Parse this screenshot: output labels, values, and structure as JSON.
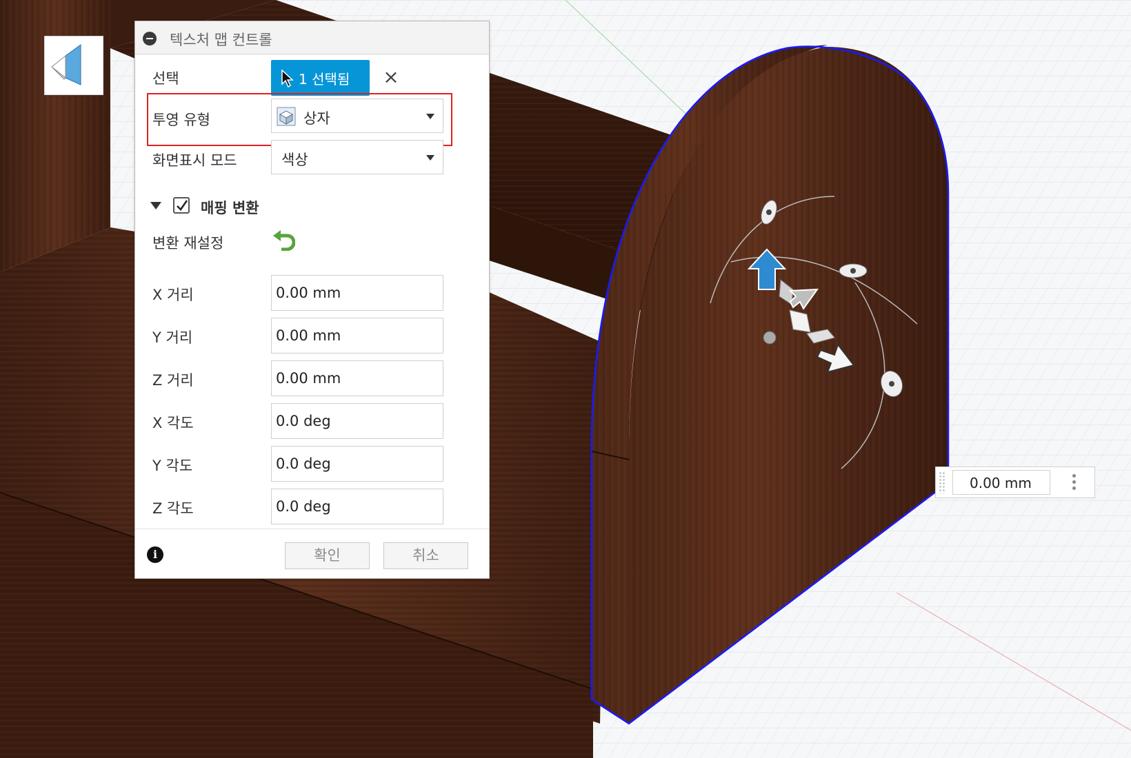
{
  "panel": {
    "title": "텍스처 맵 컨트롤",
    "selection_label": "선택",
    "selection_button": "1 선택됨",
    "projection_label": "투영 유형",
    "projection_value": "상자",
    "display_label": "화면표시 모드",
    "display_value": "색상",
    "mapping_section": "매핑 변환",
    "mapping_checked": true,
    "reset_label": "변환 재설정",
    "fields": [
      {
        "label": "X 거리",
        "value": "0.00 mm"
      },
      {
        "label": "Y 거리",
        "value": "0.00 mm"
      },
      {
        "label": "Z 거리",
        "value": "0.00 mm"
      },
      {
        "label": "X 각도",
        "value": "0.0 deg"
      },
      {
        "label": "Y 각도",
        "value": "0.0 deg"
      },
      {
        "label": "Z 각도",
        "value": "0.0 deg"
      }
    ],
    "ok_label": "확인",
    "cancel_label": "취소"
  },
  "dimension_input": {
    "value": "0.00 mm"
  },
  "icons": {
    "collapse": "minus-circle-icon",
    "cursor": "pointer-cursor-icon",
    "clear": "close-x-icon",
    "projection": "box-projection-icon",
    "reset": "reset-arrow-icon",
    "info": "info-icon",
    "viewcube": "viewcube-icon",
    "more": "more-vertical-icon"
  },
  "colors": {
    "accent": "#0696d7",
    "highlight": "#e02020",
    "wood": "#4a2617",
    "edge_selection": "#1a1aff"
  }
}
